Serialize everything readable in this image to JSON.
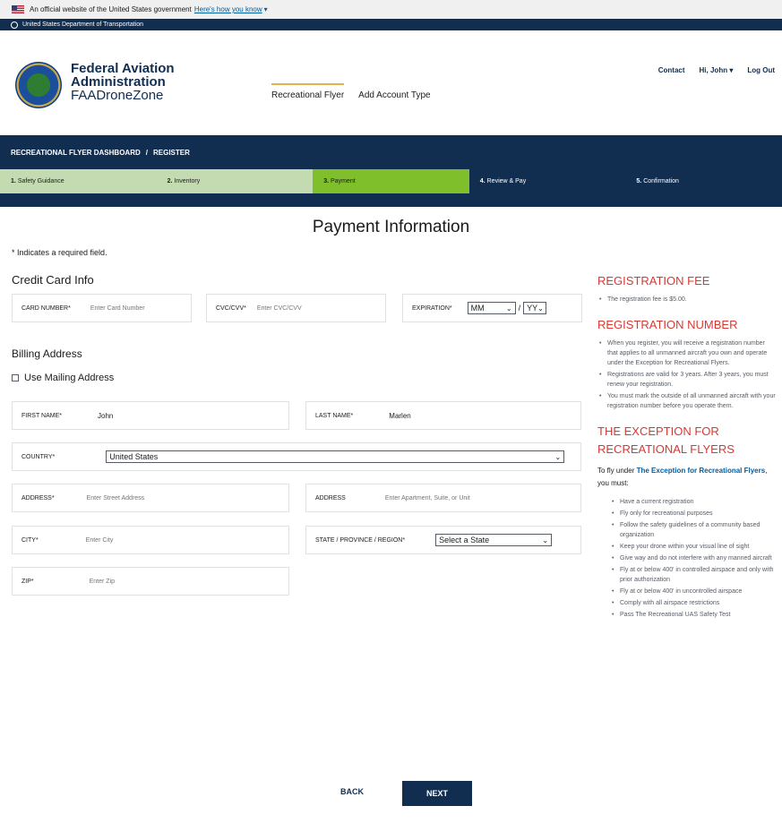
{
  "gov_banner": {
    "text": "An official website of the United States government",
    "link": "Here's how you know"
  },
  "dept_bar": {
    "text": "United States Department of Transportation"
  },
  "brand": {
    "line1": "Federal Aviation",
    "line2": "Administration",
    "line3": "FAADroneZone"
  },
  "main_nav": {
    "items": [
      "Recreational Flyer",
      "Add Account Type"
    ]
  },
  "util_nav": {
    "contact": "Contact",
    "user": "Hi, John",
    "logout": "Log Out"
  },
  "breadcrumb": {
    "dashboard": "RECREATIONAL FLYER DASHBOARD",
    "sep": "/",
    "current": "REGISTER"
  },
  "steps": [
    {
      "num": "1.",
      "label": "Safety Guidance"
    },
    {
      "num": "2.",
      "label": "Inventory"
    },
    {
      "num": "3.",
      "label": "Payment"
    },
    {
      "num": "4.",
      "label": "Review & Pay"
    },
    {
      "num": "5.",
      "label": "Confirmation"
    }
  ],
  "page": {
    "title": "Payment Information",
    "required_note": "* Indicates a required field.",
    "cc_heading": "Credit Card Info",
    "billing_heading": "Billing Address",
    "use_mailing": "Use Mailing Address"
  },
  "cc": {
    "card_label": "CARD NUMBER*",
    "card_placeholder": "Enter Card Number",
    "cvc_label": "CVC/CVV*",
    "cvc_placeholder": "Enter CVC/CVV",
    "exp_label": "EXPIRATION*",
    "exp_month": "MM",
    "exp_sep": "/",
    "exp_year": "YY"
  },
  "billing": {
    "first_label": "FIRST NAME*",
    "first_value": "John",
    "last_label": "LAST NAME*",
    "last_value": "Marlen",
    "country_label": "COUNTRY*",
    "country_value": "United States",
    "address_label": "ADDRESS*",
    "address_placeholder": "Enter Street Address",
    "address2_label": "ADDRESS",
    "address2_placeholder": "Enter Apartment, Suite, or Unit",
    "city_label": "CITY*",
    "city_placeholder": "Enter City",
    "state_label": "STATE / PROVINCE / REGION*",
    "state_value": "Select a State",
    "zip_label": "ZIP*",
    "zip_placeholder": "Enter Zip"
  },
  "side": {
    "fee_title": "REGISTRATION FEE",
    "fee_items": [
      "The registration fee is $5.00."
    ],
    "num_title": "REGISTRATION NUMBER",
    "num_items": [
      "When you register, you will receive a registration number that applies to all unmanned aircraft you own and operate under the Exception for Recreational Flyers.",
      "Registrations are valid for 3 years. After 3 years, you must renew your registration.",
      "You must mark the outside of all unmanned aircraft with your registration number before you operate them."
    ],
    "exc_title_1": "THE EXCEPTION FOR",
    "exc_title_2": "RECREATIONAL FLYERS",
    "exc_intro_pre": "To fly under",
    "exc_intro_link": "The Exception for Recreational Flyers",
    "exc_intro_post": ", you must:",
    "exc_items": [
      "Have a current registration",
      "Fly only for recreational purposes",
      "Follow the safety guidelines of a community based organization",
      "Keep your drone within your visual line of sight",
      "Give way and do not interfere with any manned aircraft",
      "Fly at or below 400' in controlled airspace and only with prior authorization",
      "Fly at or below 400' in uncontrolled airspace",
      "Comply with all airspace restrictions",
      "Pass The Recreational UAS Safety Test"
    ]
  },
  "actions": {
    "back": "BACK",
    "next": "NEXT"
  }
}
